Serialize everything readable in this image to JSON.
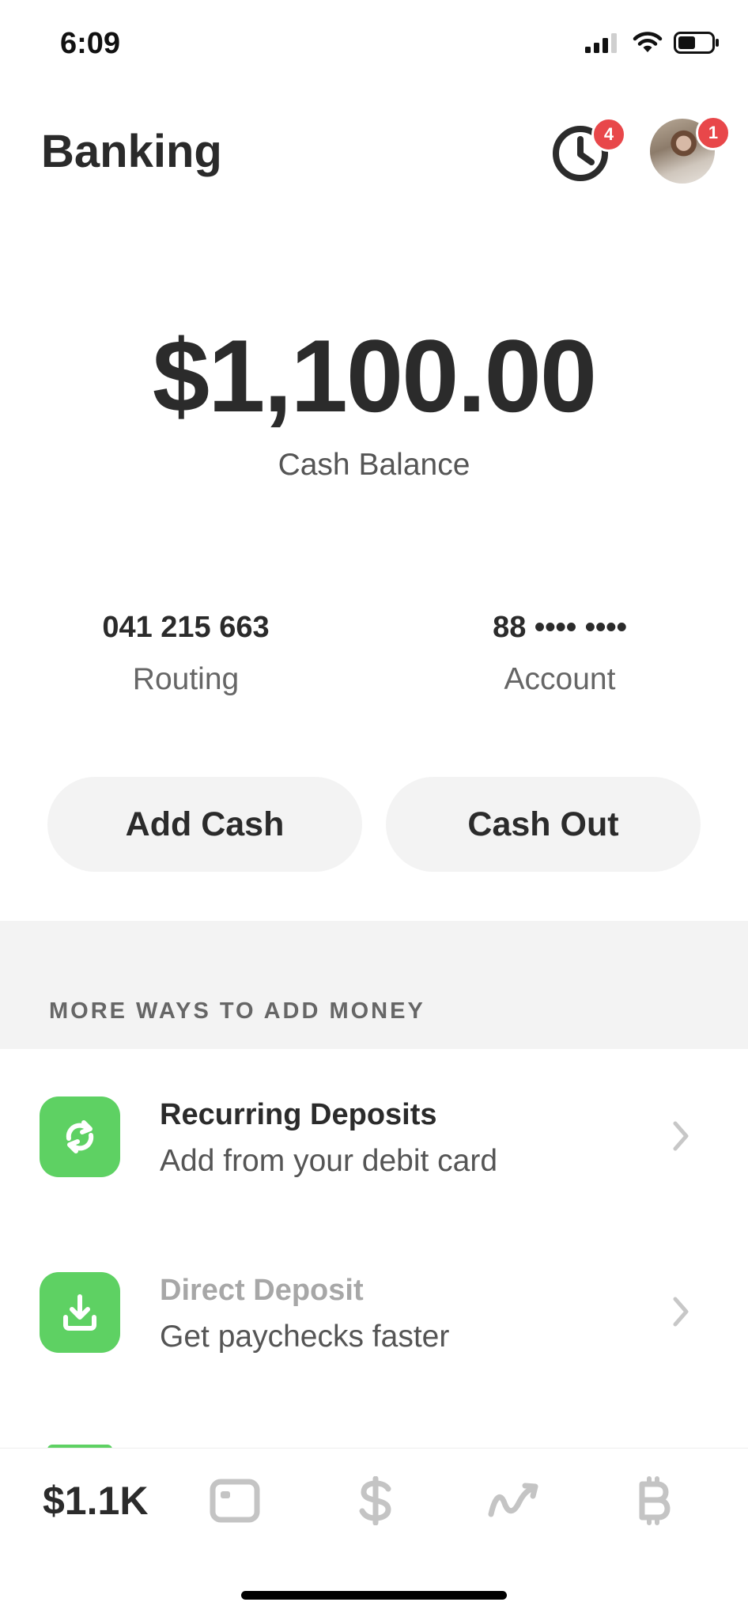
{
  "status_bar": {
    "time": "6:09",
    "icons": [
      "signal-icon",
      "wifi-icon",
      "battery-icon"
    ]
  },
  "header": {
    "title": "Banking",
    "activity_badge": "4",
    "profile_badge": "1"
  },
  "balance": {
    "amount": "$1,100.00",
    "label": "Cash Balance"
  },
  "account_info": {
    "routing_number": "041 215 663",
    "routing_label": "Routing",
    "account_number": "88 •••• ••••",
    "account_label": "Account"
  },
  "actions": {
    "add_cash": "Add Cash",
    "cash_out": "Cash Out"
  },
  "more_ways": {
    "heading": "MORE WAYS TO ADD MONEY",
    "items": [
      {
        "title": "Recurring Deposits",
        "subtitle": "Add from your debit card",
        "icon": "recurring-icon"
      },
      {
        "title": "Direct Deposit",
        "subtitle": "Get paychecks faster",
        "icon": "download-icon"
      }
    ]
  },
  "tab_bar": {
    "balance_label": "$1.1K",
    "tabs": [
      "card-icon",
      "dollar-icon",
      "investing-icon",
      "bitcoin-icon"
    ]
  },
  "colors": {
    "accent_green": "#5ed163",
    "badge_red": "#e8474a",
    "text_dark": "#2b2b2b",
    "inactive_icon": "#c4c4c4"
  }
}
